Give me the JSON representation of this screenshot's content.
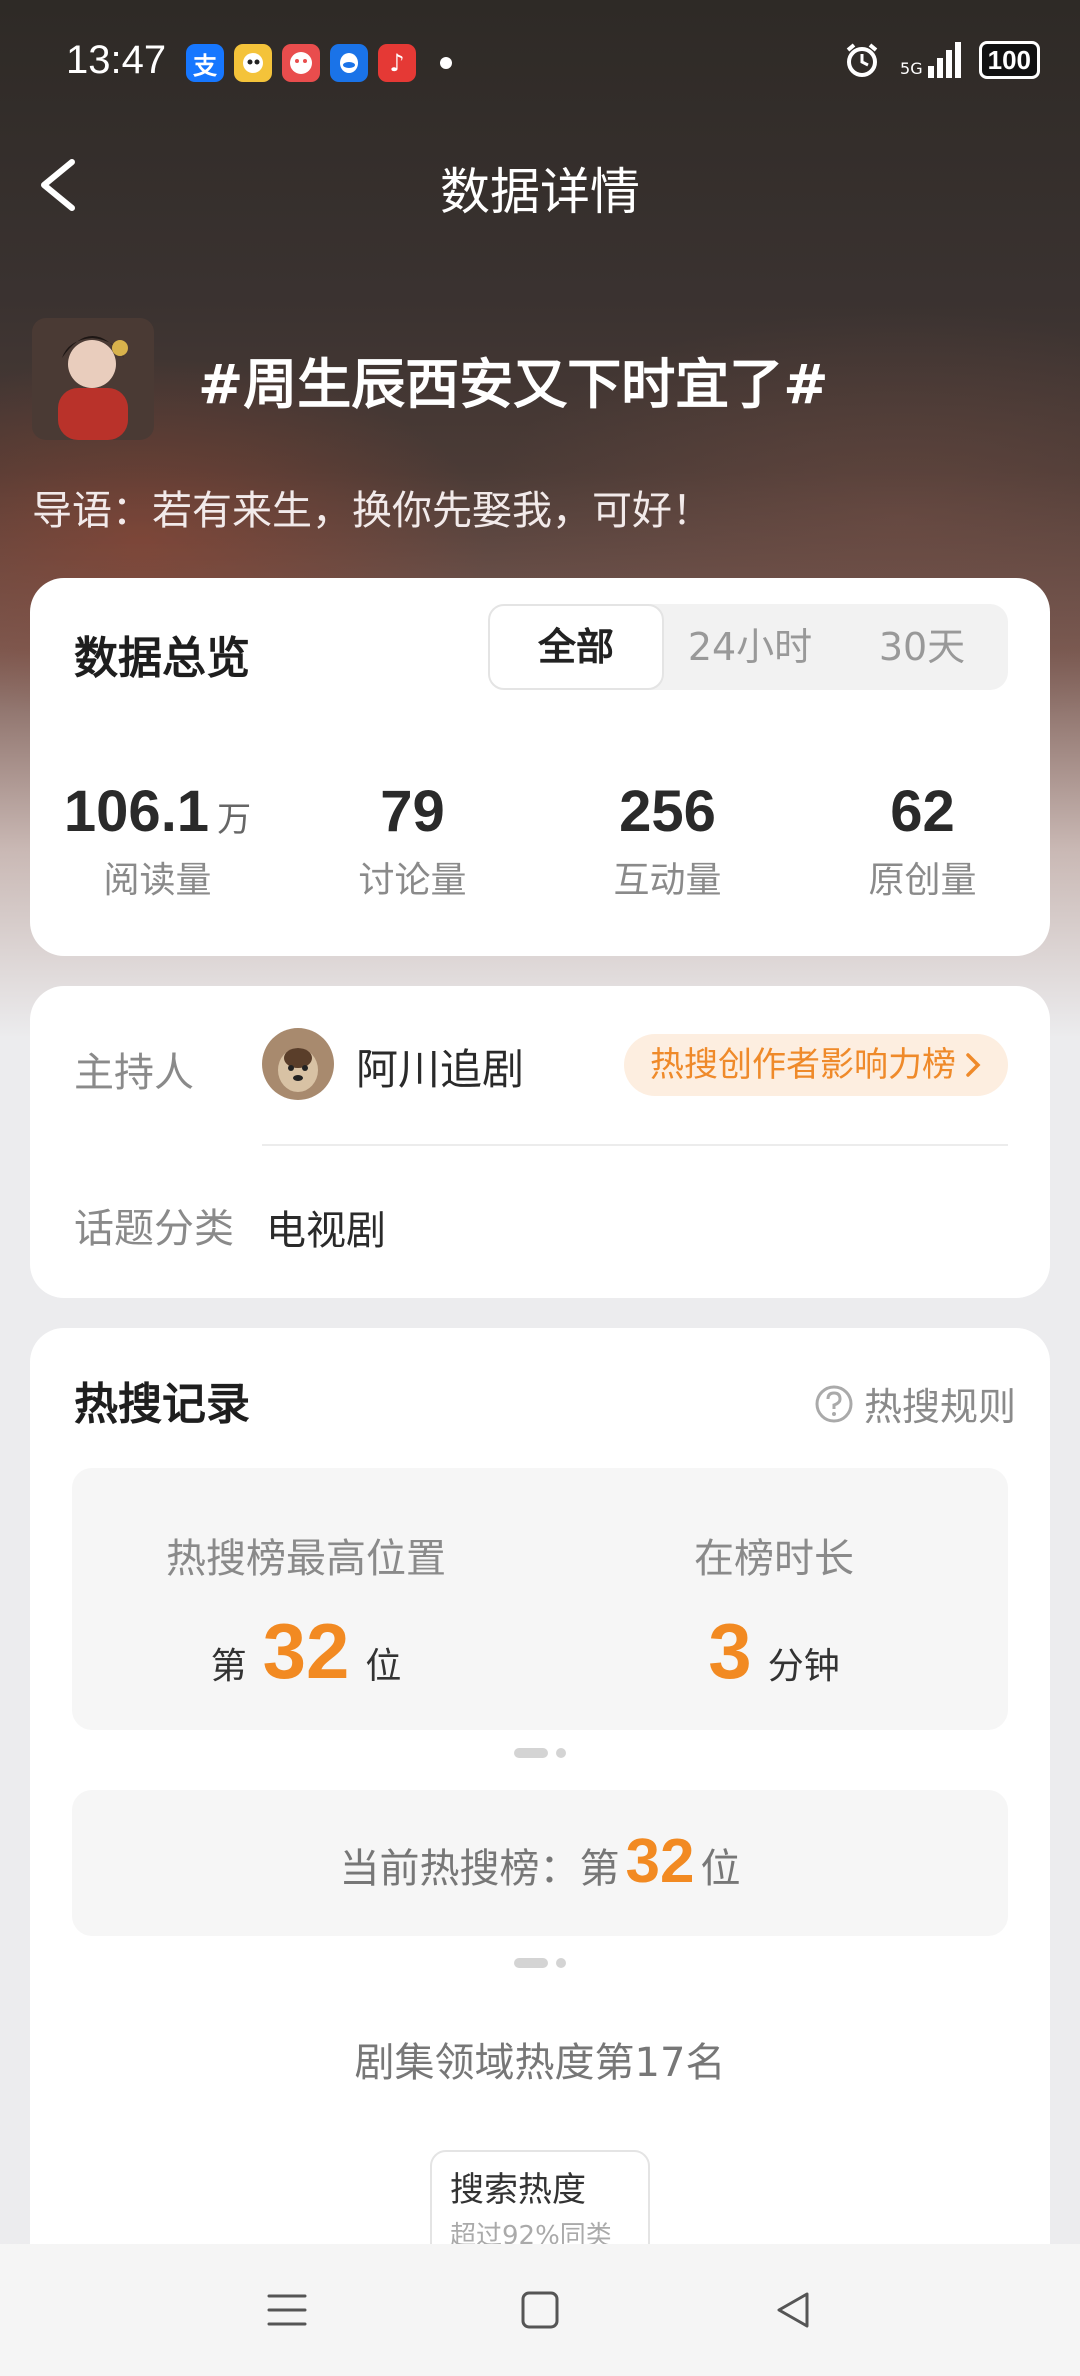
{
  "status_bar": {
    "time": "13:47",
    "network": "5G",
    "battery": "100",
    "app_icons": [
      "alipay-icon",
      "weibo-icon",
      "game-icon",
      "qq-icon",
      "music-icon"
    ]
  },
  "header": {
    "title": "数据详情"
  },
  "topic": {
    "title": "#周生辰西安又下时宜了#",
    "intro": "导语：若有来生，换你先娶我，可好！"
  },
  "overview": {
    "title": "数据总览",
    "tabs": [
      {
        "label": "全部",
        "active": true
      },
      {
        "label": "24小时",
        "active": false
      },
      {
        "label": "30天",
        "active": false
      }
    ],
    "stats": [
      {
        "value": "106.1",
        "unit": "万",
        "label": "阅读量"
      },
      {
        "value": "79",
        "unit": "",
        "label": "讨论量"
      },
      {
        "value": "256",
        "unit": "",
        "label": "互动量"
      },
      {
        "value": "62",
        "unit": "",
        "label": "原创量"
      }
    ]
  },
  "host_info": {
    "host_label": "主持人",
    "host_name": "阿川追剧",
    "badge": "热搜创作者影响力榜",
    "category_label": "话题分类",
    "category_value": "电视剧"
  },
  "hot_search": {
    "title": "热搜记录",
    "rule_link": "热搜规则",
    "best_position_label": "热搜榜最高位置",
    "best_position_prefix": "第",
    "best_position_value": "32",
    "best_position_suffix": "位",
    "duration_label": "在榜时长",
    "duration_value": "3",
    "duration_unit": "分钟",
    "current_prefix": "当前热搜榜：第",
    "current_value": "32",
    "current_suffix": "位",
    "field_rank": "剧集领域热度第17名",
    "chip_title": "搜索热度",
    "chip_sub": "超过92%同类"
  },
  "colors": {
    "accent": "#f28a22",
    "badge_bg": "#fdeee0",
    "badge_text": "#ef8a2a"
  }
}
